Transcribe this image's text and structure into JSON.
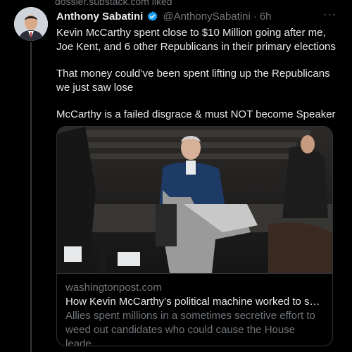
{
  "context_text": "dossier.substack.com liked",
  "author": {
    "name": "Anthony Sabatini",
    "handle": "@AnthonySabatini",
    "time": "6h",
    "verified": true
  },
  "tweet": {
    "paragraphs": [
      "Kevin McCarthy spent close to $10 Million going after me, Joe Kent, and 6 other Republicans in their primary elections",
      "That money could’ve been spent lifting up the Republicans we just saw lose",
      "McCarthy is a failed disgrace & must NOT become Speaker"
    ]
  },
  "card": {
    "domain": "washingtonpost.com",
    "title": "How Kevin McCarthy’s political machine worked to swa...",
    "description": "Allies spent millions in a sometimes secretive effort to weed out candidates who could cause the House leade..."
  },
  "icons": {
    "verified": "verified-badge-icon",
    "more": "more-options-icon"
  },
  "colors": {
    "background": "#000000",
    "text": "#e7e9ea",
    "secondary": "#71767b",
    "border": "#2f3336",
    "verified": "#1d9bf0"
  }
}
